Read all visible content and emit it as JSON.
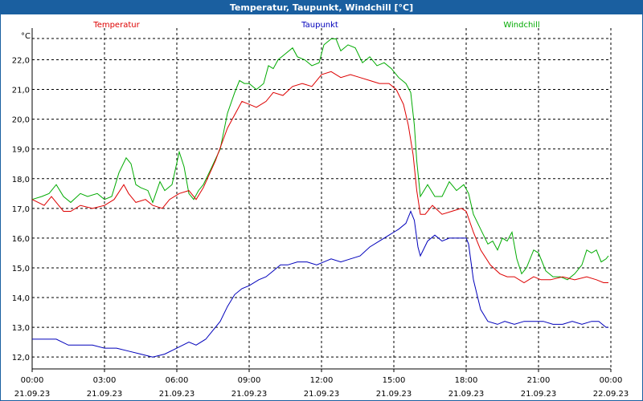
{
  "title": "Temperatur, Taupunkt, Windchill [°C]",
  "chart_data": {
    "type": "line",
    "title": "Temperatur, Taupunkt, Windchill [°C]",
    "ylabel": "°C",
    "ylim": [
      11.6,
      23.2
    ],
    "xlim": [
      0,
      24
    ],
    "yticks": [
      12.0,
      13.0,
      14.0,
      15.0,
      16.0,
      17.0,
      18.0,
      19.0,
      20.0,
      21.0,
      22.0
    ],
    "ytick_labels": [
      "12,0",
      "13,0",
      "14,0",
      "15,0",
      "16,0",
      "17,0",
      "18,0",
      "19,0",
      "20,0",
      "21,0",
      "22,0"
    ],
    "xticks": [
      0,
      3,
      6,
      9,
      12,
      15,
      18,
      21,
      24
    ],
    "xtick_labels": [
      {
        "time": "00:00",
        "date": "21.09.23"
      },
      {
        "time": "03:00",
        "date": "21.09.23"
      },
      {
        "time": "06:00",
        "date": "21.09.23"
      },
      {
        "time": "09:00",
        "date": "21.09.23"
      },
      {
        "time": "12:00",
        "date": "21.09.23"
      },
      {
        "time": "15:00",
        "date": "21.09.23"
      },
      {
        "time": "18:00",
        "date": "21.09.23"
      },
      {
        "time": "21:00",
        "date": "21.09.23"
      },
      {
        "time": "00:00",
        "date": "22.09.23"
      }
    ],
    "grid": true,
    "legend_position": "top",
    "series": [
      {
        "name": "Temperatur",
        "color": "#dd0000",
        "x": [
          0,
          0.5,
          0.8,
          1.3,
          1.6,
          2.0,
          2.5,
          3.0,
          3.4,
          3.8,
          4.0,
          4.3,
          4.7,
          5.0,
          5.4,
          5.7,
          6.1,
          6.5,
          6.8,
          7.1,
          7.6,
          8.1,
          8.5,
          8.7,
          9.0,
          9.3,
          9.7,
          10.0,
          10.4,
          10.8,
          11.2,
          11.6,
          12.0,
          12.4,
          12.8,
          13.2,
          13.6,
          14.0,
          14.4,
          14.8,
          15.1,
          15.4,
          15.6,
          15.8,
          15.95,
          16.1,
          16.3,
          16.6,
          17.0,
          17.4,
          17.8,
          18.0,
          18.3,
          18.6,
          19.0,
          19.4,
          19.7,
          20.0,
          20.4,
          20.8,
          21.1,
          21.5,
          22.0,
          22.5,
          23.0,
          23.4,
          23.7,
          23.9
        ],
        "values": [
          17.3,
          17.1,
          17.4,
          16.9,
          16.9,
          17.1,
          17.0,
          17.1,
          17.3,
          17.8,
          17.5,
          17.2,
          17.3,
          17.1,
          17.0,
          17.3,
          17.5,
          17.6,
          17.3,
          17.7,
          18.6,
          19.7,
          20.3,
          20.6,
          20.5,
          20.4,
          20.6,
          20.9,
          20.8,
          21.1,
          21.2,
          21.1,
          21.5,
          21.6,
          21.4,
          21.5,
          21.4,
          21.3,
          21.2,
          21.2,
          21.0,
          20.5,
          19.8,
          18.8,
          17.6,
          16.8,
          16.8,
          17.1,
          16.8,
          16.9,
          17.0,
          16.9,
          16.2,
          15.6,
          15.1,
          14.8,
          14.7,
          14.7,
          14.5,
          14.7,
          14.6,
          14.6,
          14.7,
          14.6,
          14.7,
          14.6,
          14.5,
          14.5
        ]
      },
      {
        "name": "Taupunkt",
        "color": "#0000bb",
        "x": [
          0,
          0.5,
          1.0,
          1.5,
          2.0,
          2.5,
          3.0,
          3.5,
          4.0,
          4.5,
          5.0,
          5.5,
          6.0,
          6.5,
          6.8,
          7.2,
          7.5,
          7.8,
          8.1,
          8.4,
          8.7,
          9.0,
          9.4,
          9.7,
          10.0,
          10.3,
          10.6,
          11.0,
          11.4,
          11.8,
          12.1,
          12.4,
          12.8,
          13.2,
          13.6,
          14.0,
          14.4,
          14.8,
          15.0,
          15.2,
          15.5,
          15.7,
          15.85,
          16.0,
          16.1,
          16.4,
          16.7,
          17.0,
          17.3,
          17.7,
          18.0,
          18.1,
          18.3,
          18.6,
          18.9,
          19.3,
          19.6,
          20.0,
          20.4,
          20.8,
          21.2,
          21.6,
          22.0,
          22.4,
          22.8,
          23.2,
          23.5,
          23.8,
          23.9
        ],
        "values": [
          12.6,
          12.6,
          12.6,
          12.4,
          12.4,
          12.4,
          12.3,
          12.3,
          12.2,
          12.1,
          12.0,
          12.1,
          12.3,
          12.5,
          12.4,
          12.6,
          12.9,
          13.2,
          13.7,
          14.1,
          14.3,
          14.4,
          14.6,
          14.7,
          14.9,
          15.1,
          15.1,
          15.2,
          15.2,
          15.1,
          15.2,
          15.3,
          15.2,
          15.3,
          15.4,
          15.7,
          15.9,
          16.1,
          16.2,
          16.3,
          16.5,
          16.9,
          16.6,
          15.7,
          15.4,
          15.9,
          16.1,
          15.9,
          16.0,
          16.0,
          16.0,
          15.8,
          14.6,
          13.6,
          13.2,
          13.1,
          13.2,
          13.1,
          13.2,
          13.2,
          13.2,
          13.1,
          13.1,
          13.2,
          13.1,
          13.2,
          13.2,
          13.0,
          13.0
        ]
      },
      {
        "name": "Windchill",
        "color": "#00aa00",
        "x": [
          0,
          0.4,
          0.7,
          1.0,
          1.3,
          1.6,
          2.0,
          2.3,
          2.7,
          3.0,
          3.3,
          3.6,
          3.9,
          4.1,
          4.3,
          4.5,
          4.8,
          5.0,
          5.3,
          5.5,
          5.8,
          6.1,
          6.3,
          6.5,
          6.7,
          6.9,
          7.1,
          7.4,
          7.8,
          8.1,
          8.4,
          8.6,
          8.8,
          9.0,
          9.3,
          9.6,
          9.8,
          10.0,
          10.2,
          10.5,
          10.8,
          11.0,
          11.3,
          11.6,
          11.9,
          12.1,
          12.4,
          12.6,
          12.8,
          13.1,
          13.4,
          13.7,
          14.0,
          14.3,
          14.6,
          14.9,
          15.2,
          15.5,
          15.7,
          15.85,
          15.95,
          16.1,
          16.4,
          16.7,
          17.0,
          17.3,
          17.6,
          17.9,
          18.1,
          18.3,
          18.6,
          18.9,
          19.1,
          19.3,
          19.5,
          19.7,
          19.9,
          20.1,
          20.3,
          20.5,
          20.8,
          21.0,
          21.3,
          21.6,
          21.9,
          22.2,
          22.5,
          22.8,
          23.0,
          23.2,
          23.4,
          23.6,
          23.8,
          23.9
        ],
        "values": [
          17.3,
          17.4,
          17.5,
          17.8,
          17.4,
          17.2,
          17.5,
          17.4,
          17.5,
          17.3,
          17.4,
          18.2,
          18.7,
          18.5,
          17.8,
          17.7,
          17.6,
          17.2,
          17.9,
          17.6,
          17.8,
          18.9,
          18.4,
          17.5,
          17.3,
          17.6,
          17.8,
          18.3,
          19.0,
          20.2,
          20.9,
          21.3,
          21.2,
          21.2,
          21.0,
          21.2,
          21.8,
          21.7,
          22.0,
          22.2,
          22.4,
          22.1,
          22.0,
          21.8,
          21.9,
          22.5,
          22.7,
          22.7,
          22.3,
          22.5,
          22.4,
          21.9,
          22.1,
          21.8,
          21.9,
          21.7,
          21.4,
          21.2,
          20.9,
          19.8,
          18.6,
          17.4,
          17.8,
          17.4,
          17.4,
          17.9,
          17.6,
          17.8,
          17.5,
          16.8,
          16.3,
          15.8,
          15.9,
          15.6,
          16.0,
          15.9,
          16.2,
          15.3,
          14.8,
          15.0,
          15.6,
          15.5,
          14.9,
          14.7,
          14.7,
          14.6,
          14.8,
          15.1,
          15.6,
          15.5,
          15.6,
          15.2,
          15.3,
          15.4
        ]
      }
    ]
  }
}
